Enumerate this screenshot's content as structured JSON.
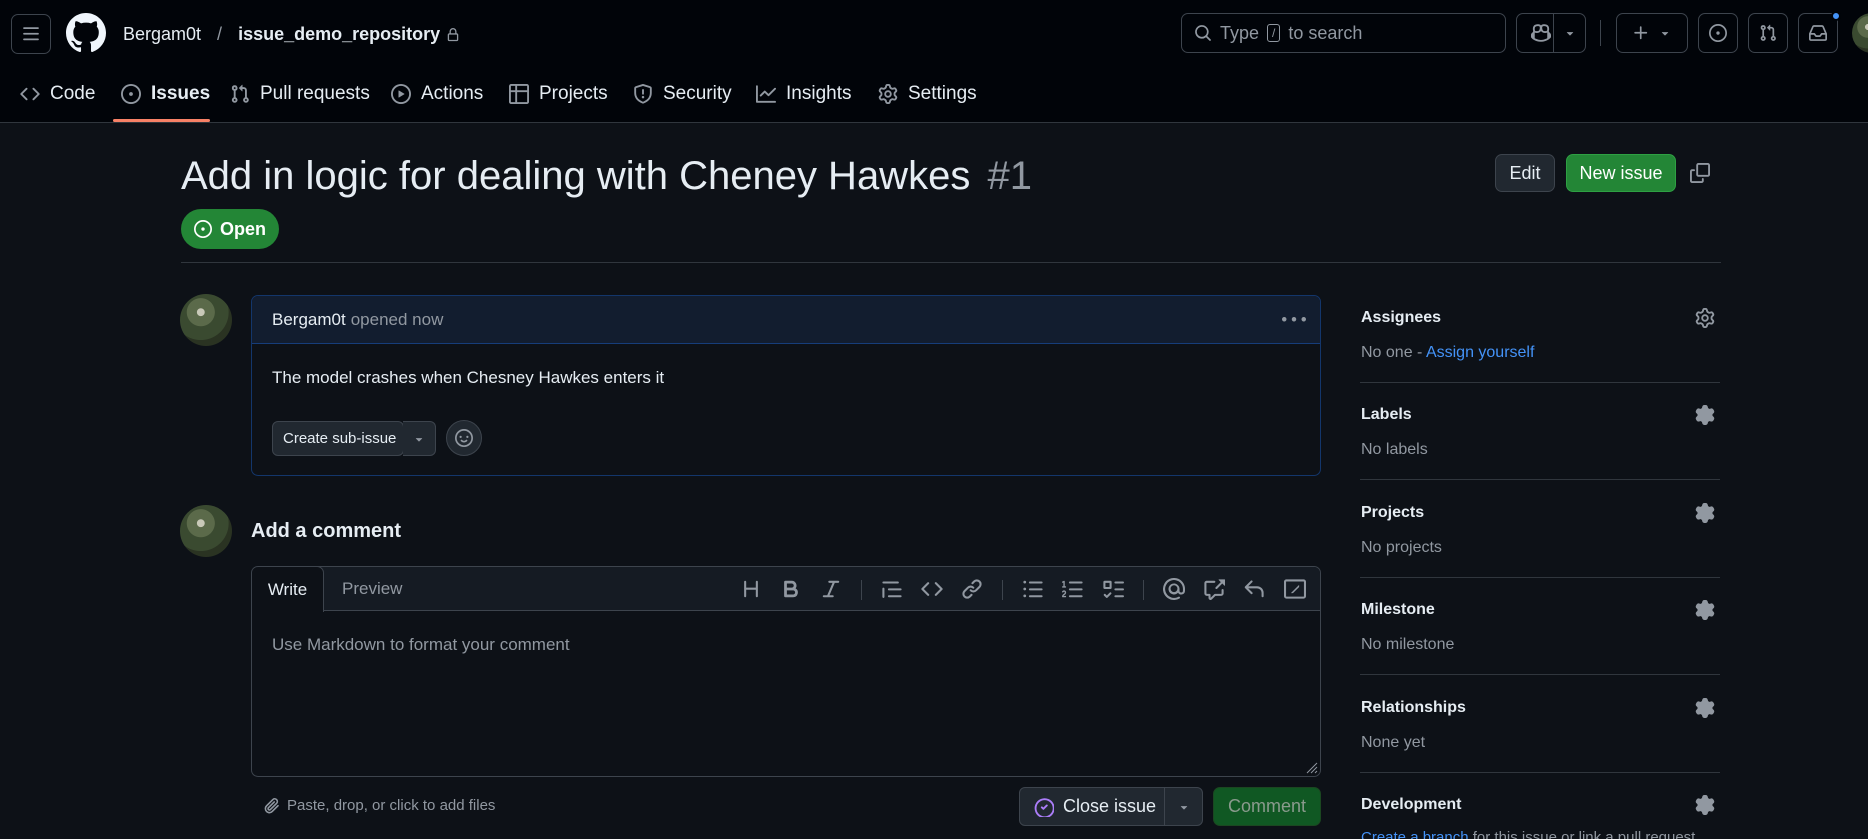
{
  "header": {
    "owner": "Bergam0t",
    "separator": "/",
    "repo": "issue_demo_repository",
    "search_prefix": "Type",
    "search_key": "/",
    "search_suffix": "to search"
  },
  "repo_nav": {
    "code": "Code",
    "issues": "Issues",
    "pull_requests": "Pull requests",
    "actions": "Actions",
    "projects": "Projects",
    "security": "Security",
    "insights": "Insights",
    "settings": "Settings"
  },
  "issue": {
    "title": "Add in logic for dealing with Cheney Hawkes",
    "number": "#1",
    "state": "Open",
    "edit_label": "Edit",
    "new_issue_label": "New issue"
  },
  "comment": {
    "author": "Bergam0t",
    "meta": "opened now",
    "body": "The model crashes when Chesney Hawkes enters it",
    "sub_issue_label": "Create sub-issue"
  },
  "composer": {
    "heading": "Add a comment",
    "tab_write": "Write",
    "tab_preview": "Preview",
    "placeholder": "Use Markdown to format your comment",
    "attach_hint": "Paste, drop, or click to add files",
    "close_issue_label": "Close issue",
    "comment_label": "Comment"
  },
  "sidebar": {
    "assignees": {
      "title": "Assignees",
      "value": "No one - ",
      "link": "Assign yourself"
    },
    "labels": {
      "title": "Labels",
      "value": "No labels"
    },
    "projects": {
      "title": "Projects",
      "value": "No projects"
    },
    "milestone": {
      "title": "Milestone",
      "value": "No milestone"
    },
    "relationships": {
      "title": "Relationships",
      "value": "None yet"
    },
    "development": {
      "title": "Development",
      "link": "Create a branch",
      "value": " for this issue or link a pull request."
    }
  },
  "colors": {
    "background": "#0d1117",
    "header": "#010409",
    "open_green": "#238636",
    "accent_link": "#4493f8",
    "issues_underline": "#f78166",
    "close_purple": "#ab7df8"
  },
  "icons": [
    "hamburger-icon",
    "github-logo-icon",
    "lock-icon",
    "search-icon",
    "copilot-icon",
    "plus-icon",
    "issue-opened-icon",
    "git-pull-request-icon",
    "inbox-icon",
    "code-icon",
    "play-icon",
    "table-icon",
    "shield-icon",
    "graph-icon",
    "gear-icon",
    "copy-icon",
    "kebab-horizontal-icon",
    "smiley-icon",
    "heading-icon",
    "bold-icon",
    "italic-icon",
    "quote-icon",
    "link-icon",
    "list-unordered-icon",
    "list-ordered-icon",
    "tasklist-icon",
    "mention-icon",
    "cross-reference-icon",
    "reply-icon",
    "fullscreen-icon",
    "paperclip-icon",
    "check-circle-icon",
    "triangle-down-icon"
  ]
}
